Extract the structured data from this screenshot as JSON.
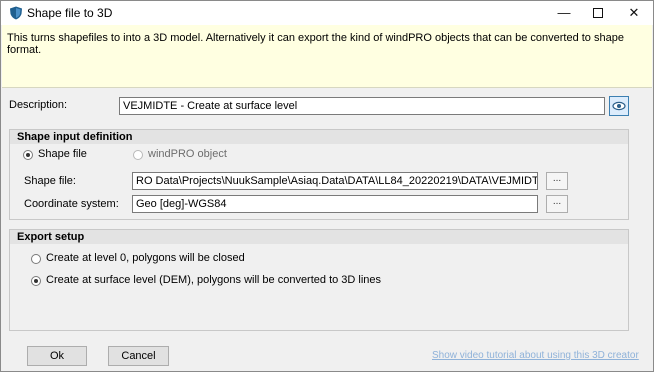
{
  "window": {
    "title": "Shape file to 3D",
    "minimize_glyph": "—",
    "close_glyph": "✕"
  },
  "info": {
    "text": "This turns shapefiles to into a 3D model. Alternatively it can export the kind of windPRO objects that can be converted to shape format."
  },
  "description": {
    "label": "Description:",
    "value": "VEJMIDTE - Create at surface level"
  },
  "shape_input": {
    "header": "Shape input definition",
    "option_shape_file": "Shape file",
    "option_windpro_object": "windPRO object",
    "selected": "Shape file",
    "shape_file_label": "Shape file:",
    "shape_file_value": "RO Data\\Projects\\NuukSample\\Asiaq.Data\\DATA\\LL84_20220219\\DATA\\VEJMIDTE.shp",
    "coordinate_system_label": "Coordinate system:",
    "coordinate_system_value": "Geo [deg]-WGS84",
    "browse_label": "..."
  },
  "export_setup": {
    "header": "Export setup",
    "option_level0": "Create at level 0, polygons will be closed",
    "option_surface": "Create at surface level (DEM), polygons will be converted to 3D lines",
    "selected": "Create at surface level (DEM), polygons will be converted to 3D lines"
  },
  "buttons": {
    "ok": "Ok",
    "cancel": "Cancel"
  },
  "footer": {
    "video_link": "Show video tutorial about using this 3D creator"
  },
  "colors": {
    "info_background": "#ffffe1",
    "group_header": "#e3e3e3",
    "link": "#8fb2d9"
  }
}
